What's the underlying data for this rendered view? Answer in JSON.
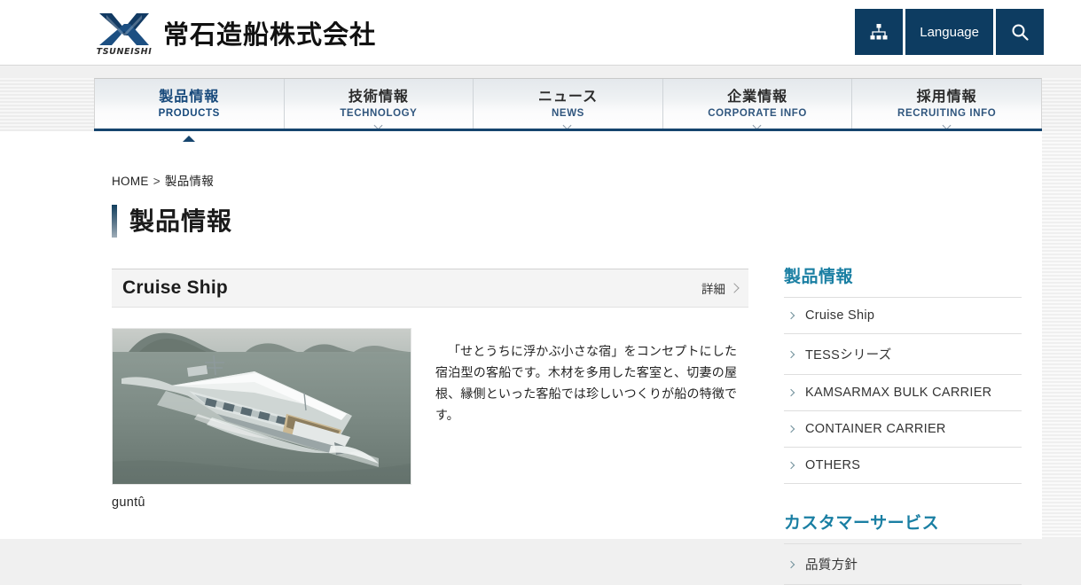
{
  "site": {
    "logo_mark": "tsuneishi-x-logo",
    "logo_text": "TSUNEISHI",
    "company_name": "常石造船株式会社"
  },
  "header": {
    "actions": [
      {
        "name": "sitemap-button",
        "icon": "sitemap-icon",
        "label": ""
      },
      {
        "name": "language-button",
        "icon": "",
        "label": "Language"
      },
      {
        "name": "search-button",
        "icon": "search-icon",
        "label": ""
      }
    ]
  },
  "globalnav": [
    {
      "ja": "製品情報",
      "en": "PRODUCTS",
      "active": true
    },
    {
      "ja": "技術情報",
      "en": "TECHNOLOGY",
      "active": false
    },
    {
      "ja": "ニュース",
      "en": "NEWS",
      "active": false
    },
    {
      "ja": "企業情報",
      "en": "CORPORATE INFO",
      "active": false
    },
    {
      "ja": "採用情報",
      "en": "RECRUITING INFO",
      "active": false
    }
  ],
  "breadcrumb": {
    "home": "HOME",
    "separator": ">",
    "current": "製品情報"
  },
  "page": {
    "title": "製品情報"
  },
  "product": {
    "heading": "Cruise Ship",
    "detail_label": "詳細",
    "image_name": "guntu-cruise-ship-photo",
    "caption": "guntû",
    "description": "「せとうちに浮かぶ小さな宿」をコンセプトにした宿泊型の客船です。木材を多用した客室と、切妻の屋根、縁側といった客船では珍しいつくりが船の特徴です。"
  },
  "sidebar": {
    "section1": {
      "heading": "製品情報",
      "items": [
        {
          "label": "Cruise Ship"
        },
        {
          "label": "TESSシリーズ"
        },
        {
          "label": "KAMSARMAX BULK CARRIER"
        },
        {
          "label": "CONTAINER CARRIER"
        },
        {
          "label": "OTHERS"
        }
      ]
    },
    "section2": {
      "heading": "カスタマーサービス",
      "items": [
        {
          "label": "品質方針"
        }
      ]
    }
  },
  "colors": {
    "brand_navy": "#0d3c61",
    "nav_underline": "#16456e",
    "sidebar_heading": "#1a7fa3",
    "page_bg": "#ffffff",
    "outer_bg": "#f0f0f0"
  }
}
